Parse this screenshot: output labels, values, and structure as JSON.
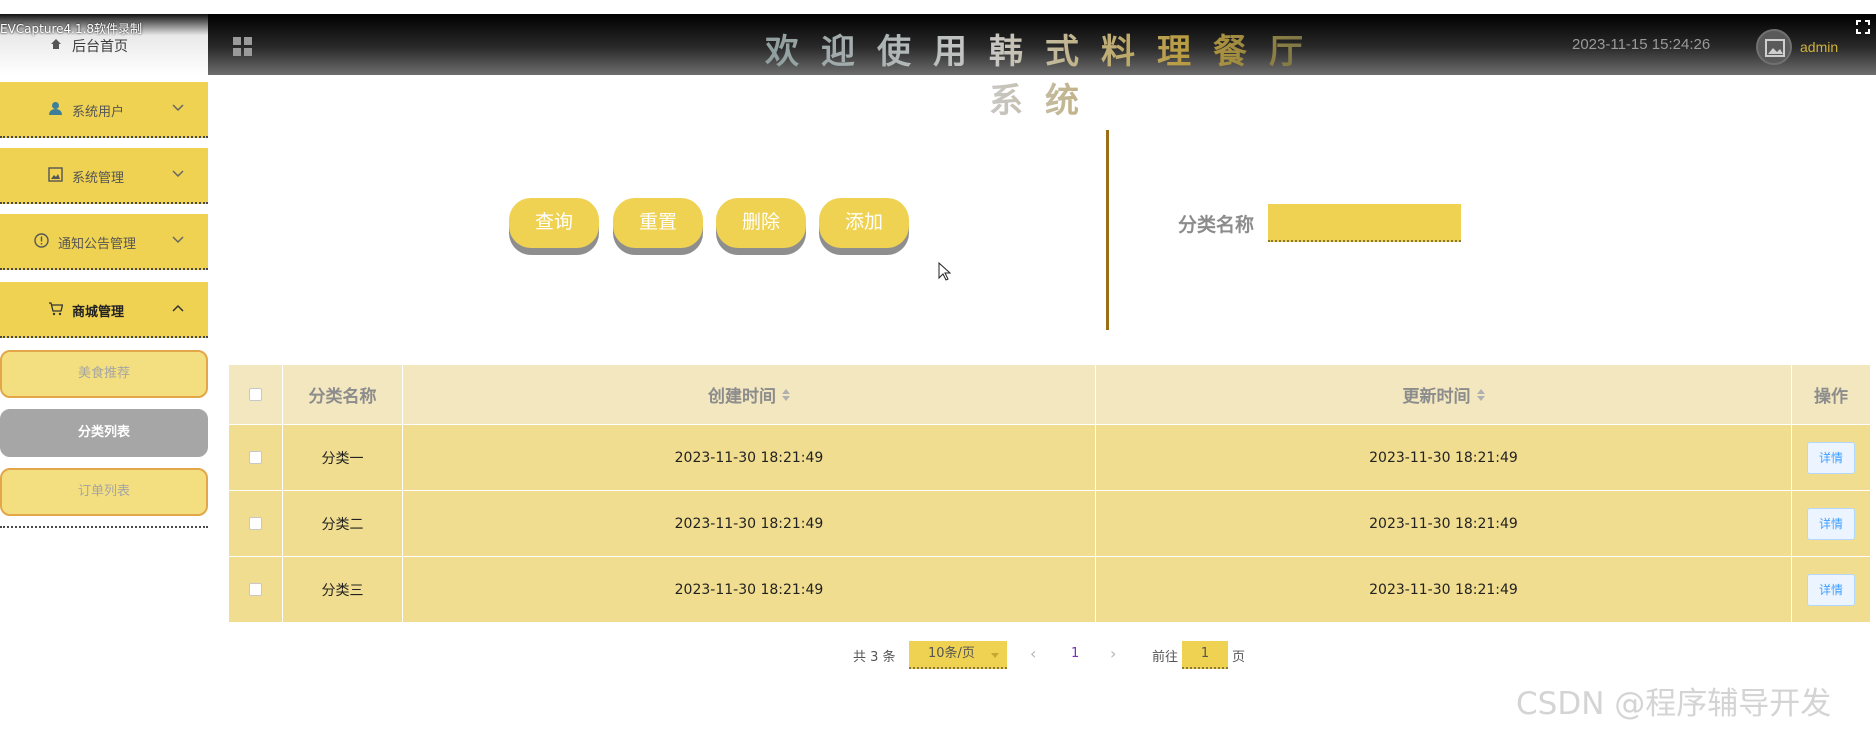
{
  "recorder": {
    "caption": "EVCapture4.1.8软件录制"
  },
  "header": {
    "title": "欢迎使用韩式料理餐厅系统",
    "datetime": "2023-11-15 15:24:26",
    "username": "admin",
    "accent_color": "#efd252"
  },
  "sidebar": {
    "home_label": "后台首页",
    "menus": [
      {
        "label": "系统用户",
        "icon": "user-icon",
        "expanded": false
      },
      {
        "label": "系统管理",
        "icon": "image-icon",
        "expanded": false
      },
      {
        "label": "通知公告管理",
        "icon": "info-icon",
        "expanded": false
      },
      {
        "label": "商城管理",
        "icon": "cart-icon",
        "expanded": true
      }
    ],
    "submenu": [
      {
        "label": "美食推荐"
      },
      {
        "label": "分类列表",
        "selected": true
      },
      {
        "label": "订单列表"
      }
    ]
  },
  "search": {
    "buttons": {
      "query": "查询",
      "reset": "重置",
      "delete": "删除",
      "add": "添加"
    },
    "field_label": "分类名称",
    "field_value": ""
  },
  "table": {
    "headers": {
      "name": "分类名称",
      "created": "创建时间",
      "updated": "更新时间",
      "action": "操作"
    },
    "rows": [
      {
        "name": "分类一",
        "created": "2023-11-30 18:21:49",
        "updated": "2023-11-30 18:21:49",
        "action": "详情"
      },
      {
        "name": "分类二",
        "created": "2023-11-30 18:21:49",
        "updated": "2023-11-30 18:21:49",
        "action": "详情"
      },
      {
        "name": "分类三",
        "created": "2023-11-30 18:21:49",
        "updated": "2023-11-30 18:21:49",
        "action": "详情"
      }
    ]
  },
  "pagination": {
    "total": "共 3 条",
    "page_size": "10条/页",
    "current_page": "1",
    "goto_label": "前往",
    "goto_value": "1",
    "page_unit": "页"
  },
  "watermark": "CSDN @程序辅导开发"
}
